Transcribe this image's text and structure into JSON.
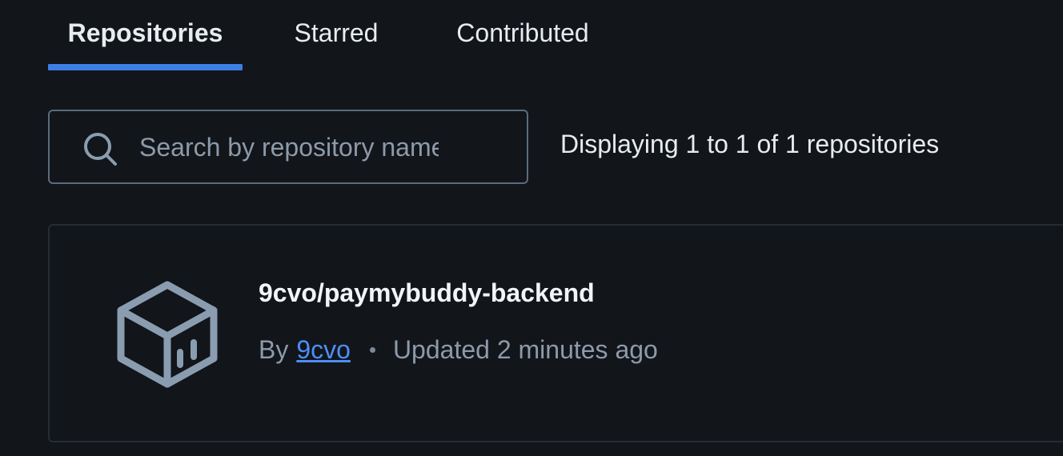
{
  "tabs": [
    {
      "label": "Repositories",
      "active": true
    },
    {
      "label": "Starred",
      "active": false
    },
    {
      "label": "Contributed",
      "active": false
    }
  ],
  "search": {
    "placeholder": "Search by repository name",
    "value": ""
  },
  "result_count": "Displaying 1 to 1 of 1 repositories",
  "repositories": [
    {
      "name": "9cvo/paymybuddy-backend",
      "by_label": "By",
      "owner": "9cvo",
      "updated": "Updated 2 minutes ago",
      "icon": "repository-cube-icon"
    }
  ],
  "colors": {
    "background": "#12151a",
    "accent": "#3d7ee6",
    "link": "#4d8ef7",
    "muted_text": "#8d9aaa",
    "icon": "#8a9db0"
  }
}
